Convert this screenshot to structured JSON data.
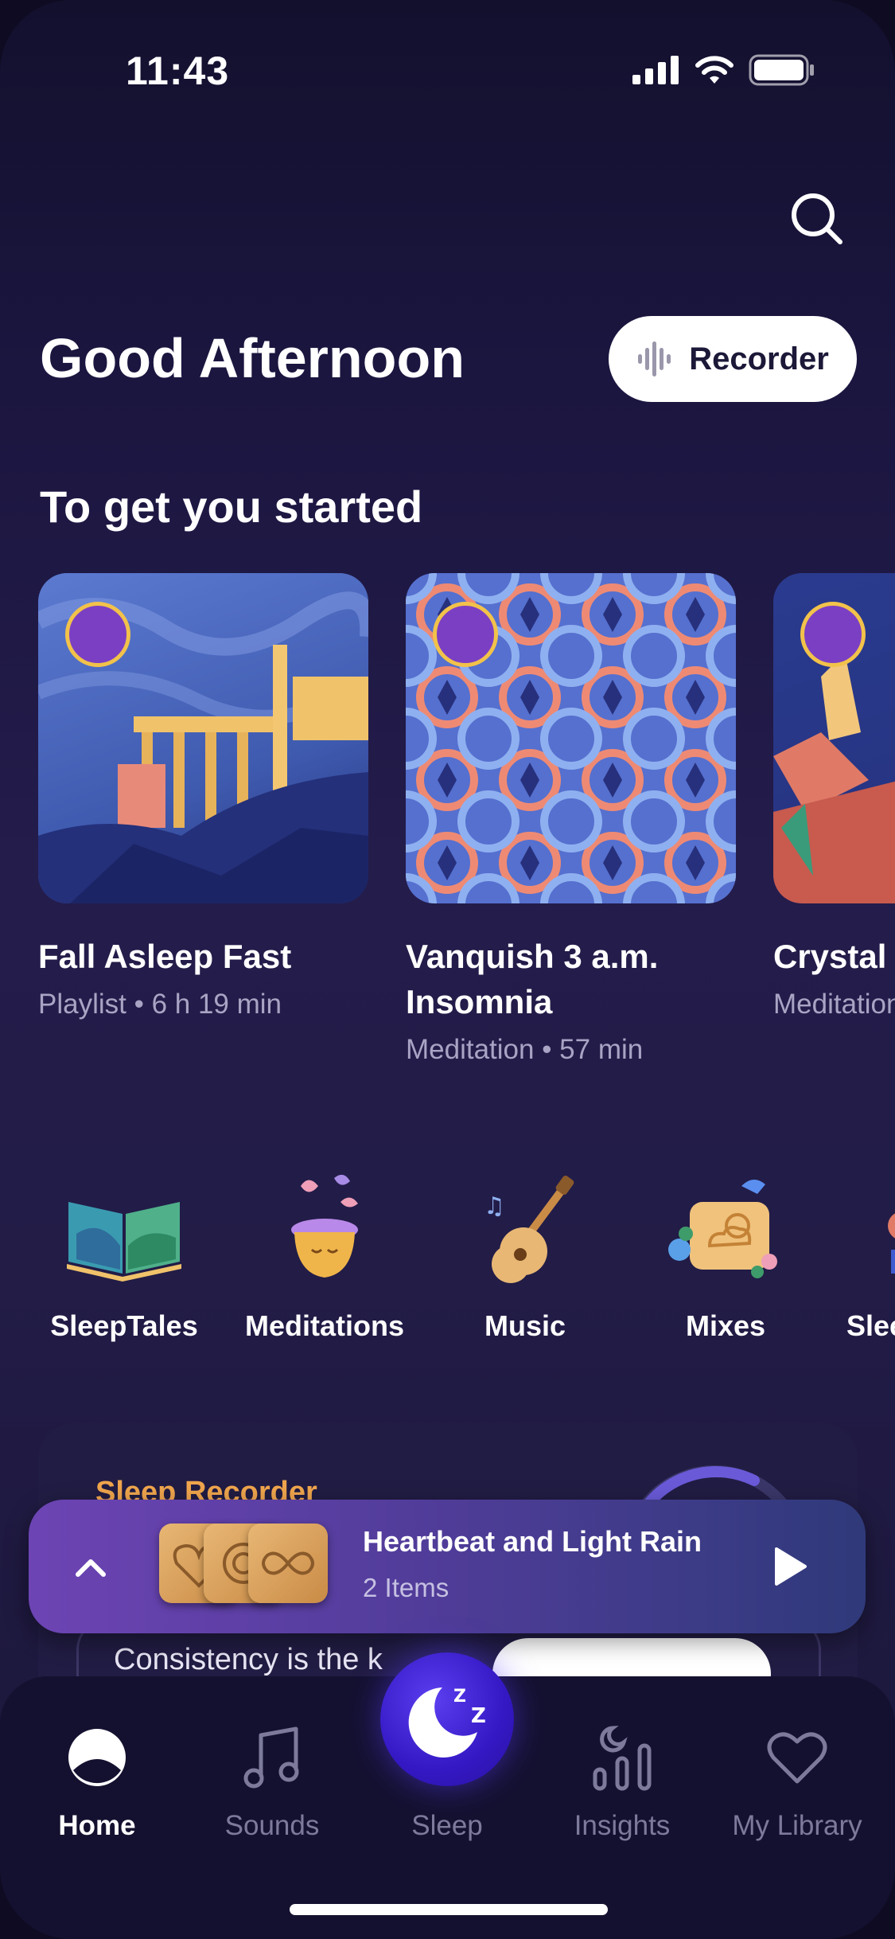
{
  "status_bar": {
    "time": "11:43"
  },
  "header": {
    "greeting": "Good Afternoon",
    "recorder_label": "Recorder"
  },
  "started": {
    "title": "To get you started",
    "cards": [
      {
        "title": "Fall Asleep Fast",
        "subtitle": "Playlist • 6 h 19 min"
      },
      {
        "title": "Vanquish 3 a.m.",
        "title2": "Insomnia",
        "subtitle": "Meditation • 57 min"
      },
      {
        "title": "Crystal",
        "subtitle": "Meditation"
      }
    ]
  },
  "categories": [
    {
      "label": "SleepTales",
      "icon": "open-book-icon"
    },
    {
      "label": "Meditations",
      "icon": "meditation-pot-icon"
    },
    {
      "label": "Music",
      "icon": "guitar-icon"
    },
    {
      "label": "Mixes",
      "icon": "weather-sign-icon"
    },
    {
      "label": "Slee",
      "icon": "sleep-category-icon"
    }
  ],
  "sleep_recorder": {
    "title": "Sleep Recorder",
    "text": "Consistency is the k"
  },
  "player": {
    "title": "Heartbeat and Light Rain",
    "subtitle": "2 Items"
  },
  "tabs": [
    {
      "label": "Home",
      "active": true
    },
    {
      "label": "Sounds"
    },
    {
      "label": "Sleep"
    },
    {
      "label": "Insights"
    },
    {
      "label": "My Library"
    }
  ],
  "colors": {
    "accent_orange": "#f0a64d",
    "sleep_button": "#3418c4",
    "player_start": "#6d44b4"
  }
}
